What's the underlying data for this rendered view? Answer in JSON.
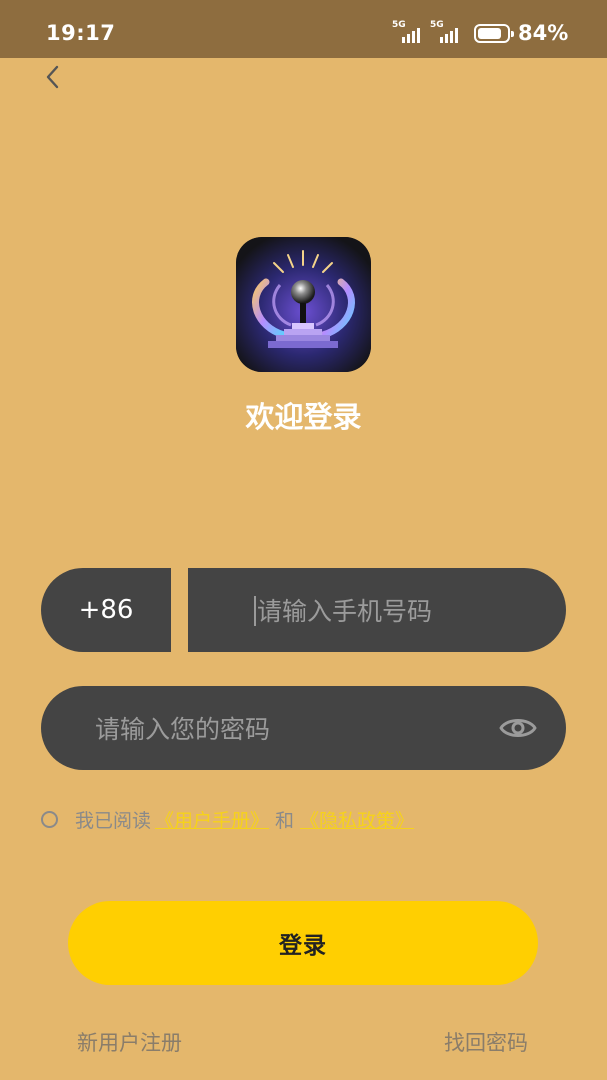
{
  "status_bar": {
    "time": "19:17",
    "signal_1_label": "5G",
    "signal_2_label": "5G",
    "battery_percent": "84%",
    "battery_level": 0.84
  },
  "nav": {
    "back_icon": "chevron-left-icon"
  },
  "header": {
    "logo_icon": "app-logo-icon",
    "welcome_title": "欢迎登录"
  },
  "form": {
    "country_code": "+86",
    "phone_placeholder": "请输入手机号码",
    "password_placeholder": "请输入您的密码",
    "show_password_icon": "eye-icon"
  },
  "agreement": {
    "prefix": "我已阅读",
    "user_manual_link": "《用户手册》",
    "conjunction": "和",
    "privacy_link": "《隐私政策》",
    "checked": false
  },
  "actions": {
    "login_label": "登录",
    "register_label": "新用户注册",
    "forgot_label": "找回密码"
  },
  "colors": {
    "background": "#E4B76C",
    "status_bar": "#8E6D3F",
    "input_bg": "#444444",
    "login_button": "#FFCF01",
    "link": "#F6D21B"
  }
}
